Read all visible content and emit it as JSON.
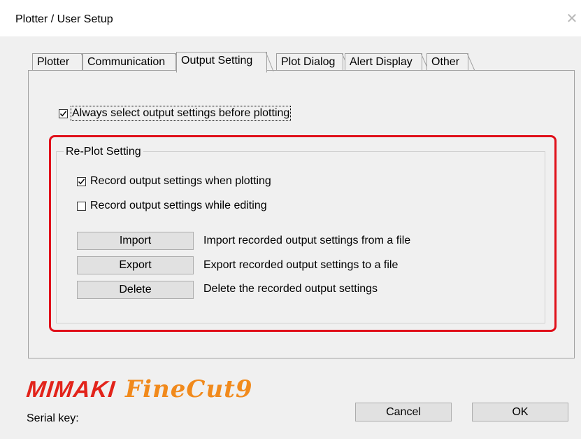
{
  "window": {
    "title": "Plotter / User Setup",
    "close_glyph": "✕"
  },
  "tabs": [
    {
      "label": "Plotter",
      "active": false
    },
    {
      "label": "Communication",
      "active": false
    },
    {
      "label": "Output Setting",
      "active": true
    },
    {
      "label": "Plot Dialog",
      "active": false
    },
    {
      "label": "Alert Display",
      "active": false
    },
    {
      "label": "Other",
      "active": false
    }
  ],
  "output_setting": {
    "always_select_label": "Always select output settings before plotting",
    "always_select_checked": true,
    "replot_group": {
      "title": "Re-Plot Setting",
      "record_when_plotting_label": "Record output settings when plotting",
      "record_when_plotting_checked": true,
      "record_while_editing_label": "Record output settings while editing",
      "record_while_editing_checked": false,
      "import_button": "Import",
      "import_desc": "Import recorded output settings from a file",
      "export_button": "Export",
      "export_desc": "Export recorded output settings to a file",
      "delete_button": "Delete",
      "delete_desc": "Delete the recorded output settings"
    }
  },
  "branding": {
    "logo_mimaki": "MIMAKI",
    "logo_finecut": "FineCut9",
    "mimaki_color": "#e2231a",
    "finecut_color": "#f18a1c"
  },
  "footer": {
    "serial_label": "Serial key:",
    "cancel_button": "Cancel",
    "ok_button": "OK"
  },
  "colors": {
    "highlight": "#e0101a",
    "dialog_bg": "#f0f0f0",
    "button_bg": "#e1e1e1"
  }
}
